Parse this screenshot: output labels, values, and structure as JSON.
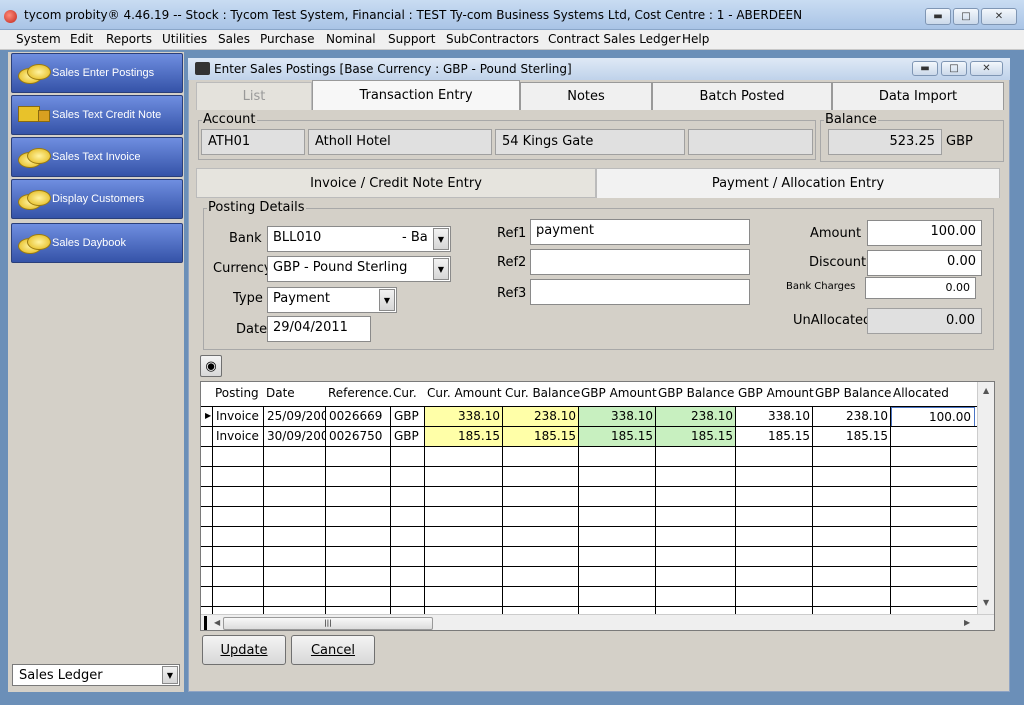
{
  "window": {
    "title": "tycom probity® 4.46.19 -- Stock : Tycom Test System, Financial : TEST Ty-com Business Systems Ltd, Cost Centre : 1 - ABERDEEN"
  },
  "menu": [
    "System",
    "Edit",
    "Reports",
    "Utilities",
    "Sales",
    "Purchase",
    "Nominal",
    "Support",
    "SubContractors",
    "Contract Sales Ledger",
    "Help"
  ],
  "nav": [
    {
      "label": "Sales Enter Postings",
      "icon": "coins-icon"
    },
    {
      "label": "Sales Text Credit Note",
      "icon": "truck-icon"
    },
    {
      "label": "Sales Text Invoice",
      "icon": "coins-icon"
    },
    {
      "label": "Display Customers",
      "icon": "coins-icon"
    },
    {
      "label": "Sales Daybook",
      "icon": "coins-icon"
    }
  ],
  "ledger_select": "Sales Ledger",
  "child_window": {
    "title": "Enter Sales Postings [Base Currency : GBP - Pound Sterling]"
  },
  "tabs": [
    "List",
    "Transaction Entry",
    "Notes",
    "Batch Posted",
    "Data Import"
  ],
  "account": {
    "label": "Account",
    "code": "ATH01",
    "name": "Atholl Hotel",
    "address": "54 Kings Gate",
    "extra": ""
  },
  "balance": {
    "label": "Balance",
    "value": "523.25",
    "currency": "GBP"
  },
  "subtabs": [
    "Invoice / Credit Note Entry",
    "Payment / Allocation Entry"
  ],
  "posting": {
    "group_label": "Posting Details",
    "bank_label": "Bank",
    "bank_value": "BLL010",
    "bank_suffix": "- Ba",
    "currency_label": "Currency",
    "currency_value": "GBP - Pound Sterling",
    "type_label": "Type",
    "type_value": "Payment",
    "date_label": "Date",
    "date_value": "29/04/2011",
    "ref1_label": "Ref1",
    "ref1_value": "payment",
    "ref2_label": "Ref2",
    "ref2_value": "",
    "ref3_label": "Ref3",
    "ref3_value": "",
    "amount_label": "Amount",
    "amount_value": "100.00",
    "discount_label": "Discount",
    "discount_value": "0.00",
    "bankcharges_label": "Bank Charges",
    "bankcharges_value": "0.00",
    "unallocated_label": "UnAllocated",
    "unallocated_value": "0.00"
  },
  "grid": {
    "columns": [
      "Posting",
      "Date",
      "Reference.",
      "Cur.",
      "Cur. Amount",
      "Cur. Balance",
      "GBP Amount",
      "GBP Balance",
      "GBP Amount",
      "GBP Balance",
      "Allocated"
    ],
    "rows": [
      [
        "Invoice",
        "25/09/200",
        "0026669",
        "GBP",
        "338.10",
        "238.10",
        "338.10",
        "238.10",
        "338.10",
        "238.10",
        "100.00"
      ],
      [
        "Invoice",
        "30/09/200",
        "0026750",
        "GBP",
        "185.15",
        "185.15",
        "185.15",
        "185.15",
        "185.15",
        "185.15",
        ""
      ]
    ],
    "colors": {
      "yellow": "#ffffa8",
      "green": "#c8f0c0"
    }
  },
  "buttons": {
    "update": "Update",
    "cancel": "Cancel"
  }
}
